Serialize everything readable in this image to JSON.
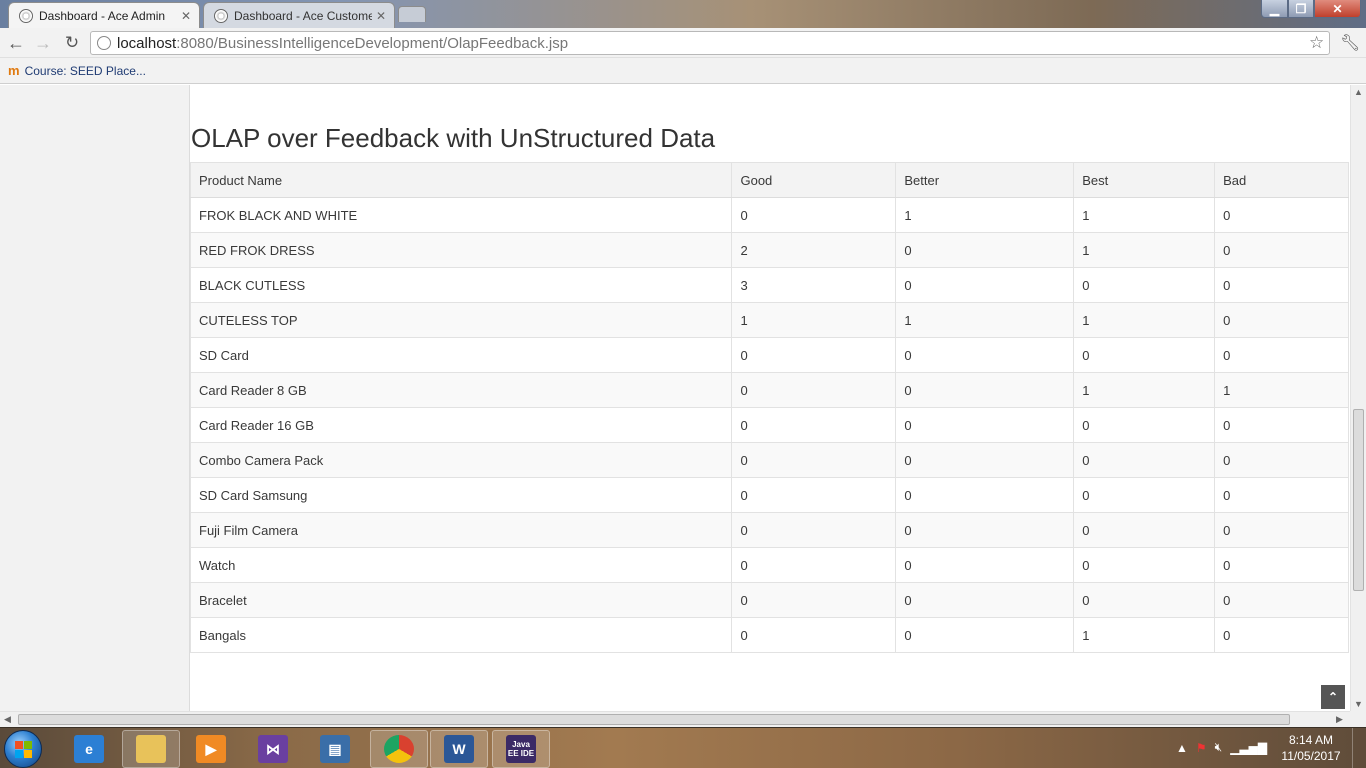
{
  "browser": {
    "tabs": [
      {
        "title": "Dashboard - Ace Admin",
        "active": true
      },
      {
        "title": "Dashboard - Ace Customer",
        "active": false
      }
    ],
    "url_host": "localhost",
    "url_rest": ":8080/BusinessIntelligenceDevelopment/OlapFeedback.jsp",
    "bookmark": "Course: SEED Place..."
  },
  "page": {
    "heading": "OLAP over Feedback with UnStructured Data",
    "table": {
      "columns": [
        "Product Name",
        "Good",
        "Better",
        "Best",
        "Bad"
      ],
      "rows": [
        [
          "FROK BLACK AND WHITE",
          "0",
          "1",
          "1",
          "0"
        ],
        [
          "RED FROK DRESS",
          "2",
          "0",
          "1",
          "0"
        ],
        [
          "BLACK CUTLESS",
          "3",
          "0",
          "0",
          "0"
        ],
        [
          "CUTELESS TOP",
          "1",
          "1",
          "1",
          "0"
        ],
        [
          "SD Card",
          "0",
          "0",
          "0",
          "0"
        ],
        [
          "Card Reader 8 GB",
          "0",
          "0",
          "1",
          "1"
        ],
        [
          "Card Reader 16 GB",
          "0",
          "0",
          "0",
          "0"
        ],
        [
          "Combo Camera Pack",
          "0",
          "0",
          "0",
          "0"
        ],
        [
          "SD Card Samsung",
          "0",
          "0",
          "0",
          "0"
        ],
        [
          "Fuji Film Camera",
          "0",
          "0",
          "0",
          "0"
        ],
        [
          "Watch",
          "0",
          "0",
          "0",
          "0"
        ],
        [
          "Bracelet",
          "0",
          "0",
          "0",
          "0"
        ],
        [
          "Bangals",
          "0",
          "0",
          "1",
          "0"
        ]
      ]
    }
  },
  "taskbar": {
    "apps": [
      {
        "name": "internet-explorer-icon",
        "running": false,
        "glyph": "e",
        "color": "#2c7fd4"
      },
      {
        "name": "file-explorer-icon",
        "running": true,
        "glyph": "",
        "color": "#e8c25a"
      },
      {
        "name": "media-player-icon",
        "running": false,
        "glyph": "▶",
        "color": "#f08a24"
      },
      {
        "name": "visual-studio-icon",
        "running": false,
        "glyph": "⋈",
        "color": "#6a3fa0"
      },
      {
        "name": "remote-desktop-icon",
        "running": false,
        "glyph": "▤",
        "color": "#3a6ea8"
      },
      {
        "name": "chrome-icon",
        "running": true,
        "glyph": "",
        "color": "#d9412f"
      },
      {
        "name": "word-icon",
        "running": true,
        "glyph": "W",
        "color": "#2b5797"
      },
      {
        "name": "java-ee-ide-icon",
        "running": true,
        "glyph": "Java EE IDE",
        "color": "#3b2a66"
      }
    ],
    "clock_time": "8:14 AM",
    "clock_date": "11/05/2017"
  },
  "colors": {
    "sidebar_bg": "#f2f2f2",
    "header_row_bg": "#f3f3f3",
    "stripe_row_bg": "#f9f9f9"
  }
}
